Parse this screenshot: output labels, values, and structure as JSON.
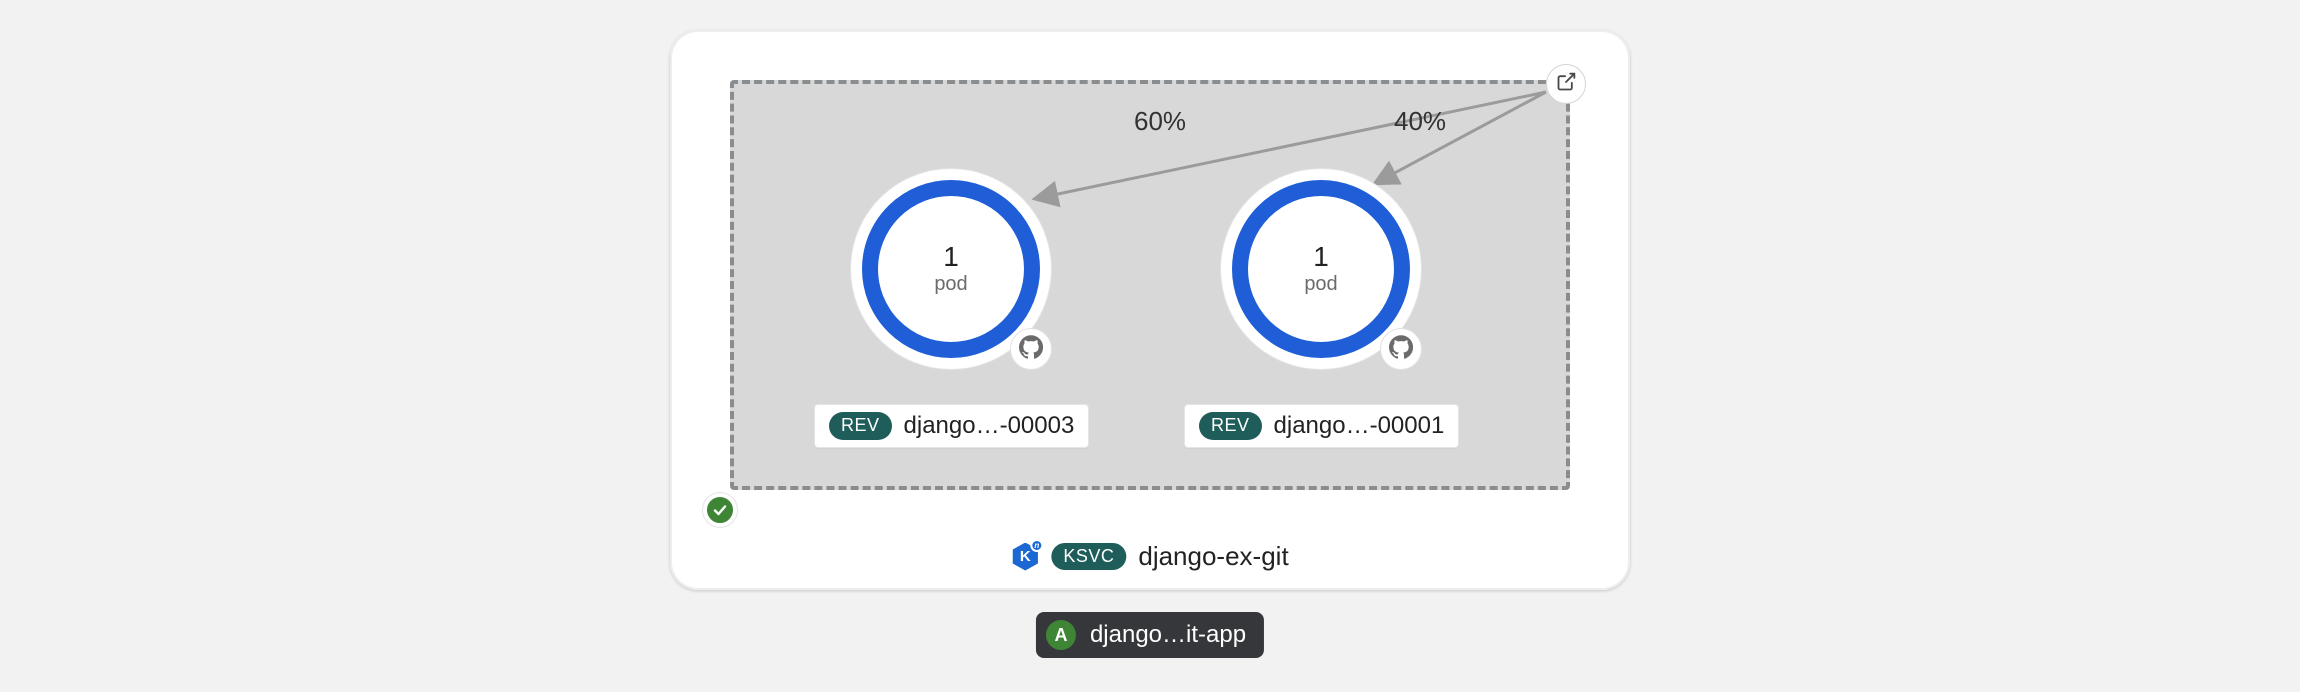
{
  "traffic": {
    "left_pct": "60%",
    "right_pct": "40%"
  },
  "pods": {
    "a": {
      "count": "1",
      "label": "pod"
    },
    "b": {
      "count": "1",
      "label": "pod"
    }
  },
  "revisions": {
    "badge_text": "REV",
    "a_name": "django…-00003",
    "b_name": "django…-00001"
  },
  "service": {
    "badge_text": "KSVC",
    "name": "django-ex-git",
    "icon_letter": "K",
    "icon_mini": "n"
  },
  "app": {
    "letter": "A",
    "name": "django…it-app"
  },
  "status": "ok"
}
